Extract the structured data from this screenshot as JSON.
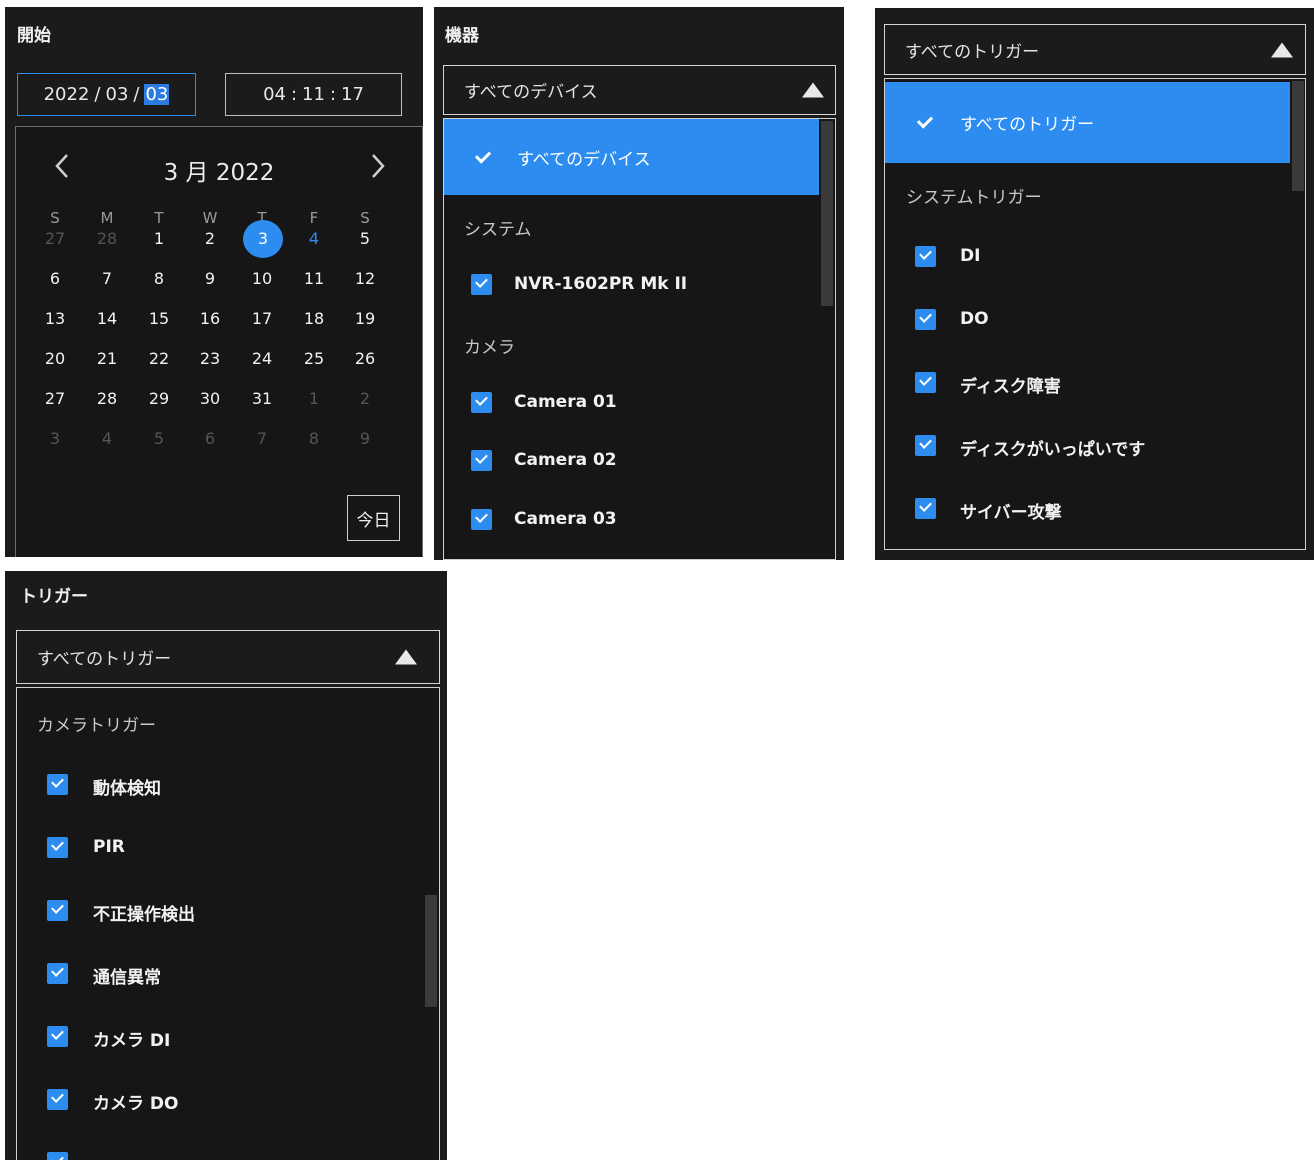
{
  "date_panel": {
    "title": "開始",
    "date_year": "2022",
    "date_sep": "/",
    "date_month": "03",
    "date_day": "03",
    "time_h": "04",
    "time_sep": ":",
    "time_m": "11",
    "time_s": "17",
    "prev_label": "‹",
    "next_label": "›",
    "month_label": "3 月 2022",
    "weekdays": [
      "S",
      "M",
      "T",
      "W",
      "T",
      "F",
      "S"
    ],
    "weeks": [
      [
        "27",
        "28",
        "1",
        "2",
        "3",
        "4",
        "5"
      ],
      [
        "6",
        "7",
        "8",
        "9",
        "10",
        "11",
        "12"
      ],
      [
        "13",
        "14",
        "15",
        "16",
        "17",
        "18",
        "19"
      ],
      [
        "20",
        "21",
        "22",
        "23",
        "24",
        "25",
        "26"
      ],
      [
        "27",
        "28",
        "29",
        "30",
        "31",
        "1",
        "2"
      ],
      [
        "3",
        "4",
        "5",
        "6",
        "7",
        "8",
        "9"
      ]
    ],
    "today_button": "今日"
  },
  "device_panel": {
    "title": "機器",
    "selected_value": "すべてのデバイス",
    "all_option": "すべてのデバイス",
    "group_system": "システム",
    "system_items": [
      "NVR-1602PR Mk II"
    ],
    "group_camera": "カメラ",
    "camera_items": [
      "Camera 01",
      "Camera 02",
      "Camera 03"
    ]
  },
  "trigger_panel_a": {
    "selected_value": "すべてのトリガー",
    "all_option": "すべてのトリガー",
    "group_system": "システムトリガー",
    "items": [
      "DI",
      "DO",
      "ディスク障害",
      "ディスクがいっぱいです",
      "サイバー攻撃"
    ]
  },
  "trigger_panel_b": {
    "title": "トリガー",
    "selected_value": "すべてのトリガー",
    "group_camera": "カメラトリガー",
    "items": [
      "動体検知",
      "PIR",
      "不正操作検出",
      "通信異常",
      "カメラ DI",
      "カメラ DO"
    ]
  },
  "colors": {
    "accent": "#2d8cf0",
    "panel_bg": "#1b1b1b",
    "text": "#e6e6e6"
  }
}
